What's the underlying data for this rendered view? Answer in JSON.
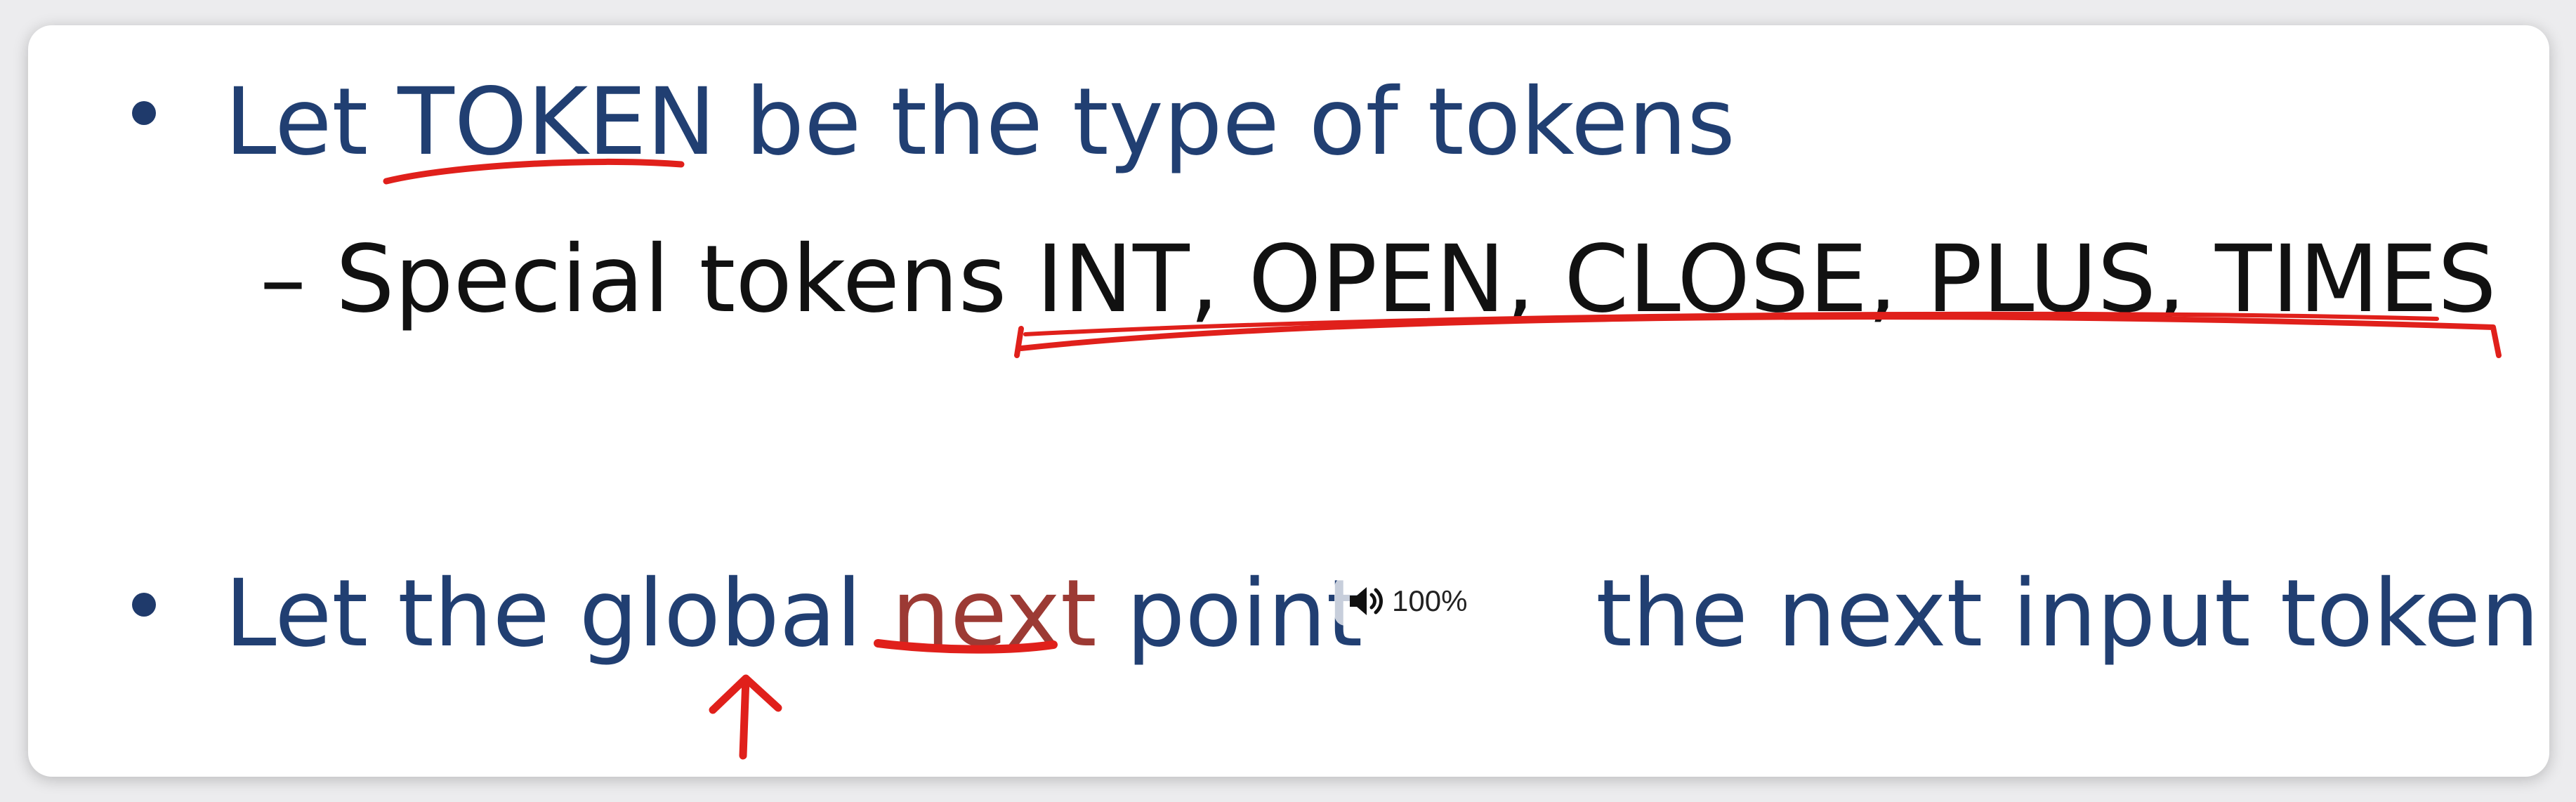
{
  "slide": {
    "line1": {
      "pre": "Let ",
      "highlight": "TOKEN",
      "post": " be the type of tokens"
    },
    "line2": {
      "dash": "–",
      "pre": "Special tokens ",
      "highlight": "INT, OPEN, CLOSE, PLUS, TIMES"
    },
    "line3": {
      "pre": "Let the global ",
      "highlight": "next",
      "post1": " point",
      "post2": " the next input token"
    }
  },
  "overlay": {
    "volume_icon": "speaker-icon",
    "volume_text": "100%"
  },
  "colors": {
    "bullet_text": "#213f72",
    "sub_text": "#111111",
    "annotation": "#e0201b"
  }
}
